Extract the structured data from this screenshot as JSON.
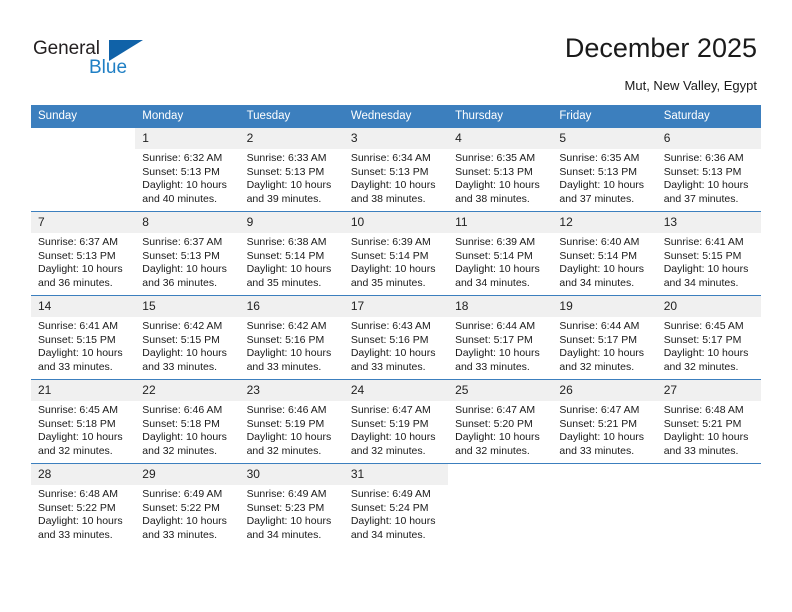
{
  "brand": {
    "name_part1": "General",
    "name_part2": "Blue",
    "accent_color": "#1062a8",
    "text_color": "#231f20"
  },
  "header": {
    "title": "December 2025",
    "subtitle": "Mut, New Valley, Egypt",
    "header_bg_color": "#3c7fbe",
    "daynum_bg_color": "#f0f0f0"
  },
  "weekdays": [
    "Sunday",
    "Monday",
    "Tuesday",
    "Wednesday",
    "Thursday",
    "Friday",
    "Saturday"
  ],
  "labels": {
    "sunrise_prefix": "Sunrise:",
    "sunset_prefix": "Sunset:",
    "daylight_prefix": "Daylight:"
  },
  "weeks": [
    [
      {
        "empty": true
      },
      {
        "day": "1",
        "sunrise": "Sunrise: 6:32 AM",
        "sunset": "Sunset: 5:13 PM",
        "daylight": "Daylight: 10 hours and 40 minutes."
      },
      {
        "day": "2",
        "sunrise": "Sunrise: 6:33 AM",
        "sunset": "Sunset: 5:13 PM",
        "daylight": "Daylight: 10 hours and 39 minutes."
      },
      {
        "day": "3",
        "sunrise": "Sunrise: 6:34 AM",
        "sunset": "Sunset: 5:13 PM",
        "daylight": "Daylight: 10 hours and 38 minutes."
      },
      {
        "day": "4",
        "sunrise": "Sunrise: 6:35 AM",
        "sunset": "Sunset: 5:13 PM",
        "daylight": "Daylight: 10 hours and 38 minutes."
      },
      {
        "day": "5",
        "sunrise": "Sunrise: 6:35 AM",
        "sunset": "Sunset: 5:13 PM",
        "daylight": "Daylight: 10 hours and 37 minutes."
      },
      {
        "day": "6",
        "sunrise": "Sunrise: 6:36 AM",
        "sunset": "Sunset: 5:13 PM",
        "daylight": "Daylight: 10 hours and 37 minutes."
      }
    ],
    [
      {
        "day": "7",
        "sunrise": "Sunrise: 6:37 AM",
        "sunset": "Sunset: 5:13 PM",
        "daylight": "Daylight: 10 hours and 36 minutes."
      },
      {
        "day": "8",
        "sunrise": "Sunrise: 6:37 AM",
        "sunset": "Sunset: 5:13 PM",
        "daylight": "Daylight: 10 hours and 36 minutes."
      },
      {
        "day": "9",
        "sunrise": "Sunrise: 6:38 AM",
        "sunset": "Sunset: 5:14 PM",
        "daylight": "Daylight: 10 hours and 35 minutes."
      },
      {
        "day": "10",
        "sunrise": "Sunrise: 6:39 AM",
        "sunset": "Sunset: 5:14 PM",
        "daylight": "Daylight: 10 hours and 35 minutes."
      },
      {
        "day": "11",
        "sunrise": "Sunrise: 6:39 AM",
        "sunset": "Sunset: 5:14 PM",
        "daylight": "Daylight: 10 hours and 34 minutes."
      },
      {
        "day": "12",
        "sunrise": "Sunrise: 6:40 AM",
        "sunset": "Sunset: 5:14 PM",
        "daylight": "Daylight: 10 hours and 34 minutes."
      },
      {
        "day": "13",
        "sunrise": "Sunrise: 6:41 AM",
        "sunset": "Sunset: 5:15 PM",
        "daylight": "Daylight: 10 hours and 34 minutes."
      }
    ],
    [
      {
        "day": "14",
        "sunrise": "Sunrise: 6:41 AM",
        "sunset": "Sunset: 5:15 PM",
        "daylight": "Daylight: 10 hours and 33 minutes."
      },
      {
        "day": "15",
        "sunrise": "Sunrise: 6:42 AM",
        "sunset": "Sunset: 5:15 PM",
        "daylight": "Daylight: 10 hours and 33 minutes."
      },
      {
        "day": "16",
        "sunrise": "Sunrise: 6:42 AM",
        "sunset": "Sunset: 5:16 PM",
        "daylight": "Daylight: 10 hours and 33 minutes."
      },
      {
        "day": "17",
        "sunrise": "Sunrise: 6:43 AM",
        "sunset": "Sunset: 5:16 PM",
        "daylight": "Daylight: 10 hours and 33 minutes."
      },
      {
        "day": "18",
        "sunrise": "Sunrise: 6:44 AM",
        "sunset": "Sunset: 5:17 PM",
        "daylight": "Daylight: 10 hours and 33 minutes."
      },
      {
        "day": "19",
        "sunrise": "Sunrise: 6:44 AM",
        "sunset": "Sunset: 5:17 PM",
        "daylight": "Daylight: 10 hours and 32 minutes."
      },
      {
        "day": "20",
        "sunrise": "Sunrise: 6:45 AM",
        "sunset": "Sunset: 5:17 PM",
        "daylight": "Daylight: 10 hours and 32 minutes."
      }
    ],
    [
      {
        "day": "21",
        "sunrise": "Sunrise: 6:45 AM",
        "sunset": "Sunset: 5:18 PM",
        "daylight": "Daylight: 10 hours and 32 minutes."
      },
      {
        "day": "22",
        "sunrise": "Sunrise: 6:46 AM",
        "sunset": "Sunset: 5:18 PM",
        "daylight": "Daylight: 10 hours and 32 minutes."
      },
      {
        "day": "23",
        "sunrise": "Sunrise: 6:46 AM",
        "sunset": "Sunset: 5:19 PM",
        "daylight": "Daylight: 10 hours and 32 minutes."
      },
      {
        "day": "24",
        "sunrise": "Sunrise: 6:47 AM",
        "sunset": "Sunset: 5:19 PM",
        "daylight": "Daylight: 10 hours and 32 minutes."
      },
      {
        "day": "25",
        "sunrise": "Sunrise: 6:47 AM",
        "sunset": "Sunset: 5:20 PM",
        "daylight": "Daylight: 10 hours and 32 minutes."
      },
      {
        "day": "26",
        "sunrise": "Sunrise: 6:47 AM",
        "sunset": "Sunset: 5:21 PM",
        "daylight": "Daylight: 10 hours and 33 minutes."
      },
      {
        "day": "27",
        "sunrise": "Sunrise: 6:48 AM",
        "sunset": "Sunset: 5:21 PM",
        "daylight": "Daylight: 10 hours and 33 minutes."
      }
    ],
    [
      {
        "day": "28",
        "sunrise": "Sunrise: 6:48 AM",
        "sunset": "Sunset: 5:22 PM",
        "daylight": "Daylight: 10 hours and 33 minutes."
      },
      {
        "day": "29",
        "sunrise": "Sunrise: 6:49 AM",
        "sunset": "Sunset: 5:22 PM",
        "daylight": "Daylight: 10 hours and 33 minutes."
      },
      {
        "day": "30",
        "sunrise": "Sunrise: 6:49 AM",
        "sunset": "Sunset: 5:23 PM",
        "daylight": "Daylight: 10 hours and 34 minutes."
      },
      {
        "day": "31",
        "sunrise": "Sunrise: 6:49 AM",
        "sunset": "Sunset: 5:24 PM",
        "daylight": "Daylight: 10 hours and 34 minutes."
      },
      {
        "empty": true
      },
      {
        "empty": true
      },
      {
        "empty": true
      }
    ]
  ]
}
